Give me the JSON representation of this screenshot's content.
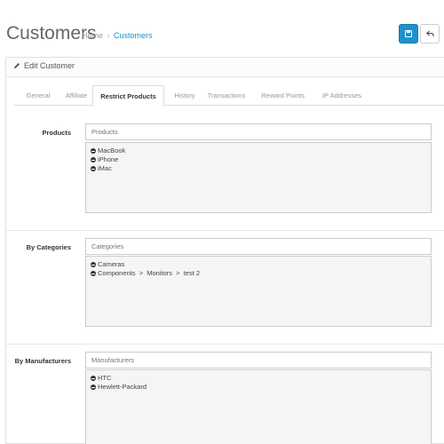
{
  "header": {
    "title": "Customers",
    "breadcrumb": {
      "home": "Home",
      "separator": "›",
      "current": "Customers"
    },
    "save_icon": "floppy-disk-icon",
    "back_icon": "reply-arrow-icon",
    "accent_color": "#1e91cf"
  },
  "panel": {
    "title": "Edit Customer",
    "title_icon": "pencil-icon"
  },
  "tabs": [
    {
      "label": "General"
    },
    {
      "label": "Affiliate"
    },
    {
      "label": "Restrict Products",
      "active": true
    },
    {
      "label": "History"
    },
    {
      "label": "Transactions"
    },
    {
      "label": "Reward Points"
    },
    {
      "label": "IP Addresses"
    }
  ],
  "sections": {
    "products": {
      "label": "Products",
      "placeholder": "Products",
      "items": [
        "MacBook",
        "iPhone",
        "iMac"
      ]
    },
    "categories": {
      "label": "By Categories",
      "placeholder": "Categories",
      "items": [
        "Cameras",
        "Components  >  Monitors  >  test 2"
      ]
    },
    "manufacturers": {
      "label": "By Manufacturers",
      "placeholder": "Manufacturers",
      "items": [
        "HTC",
        "Hewlett-Packard"
      ]
    }
  }
}
